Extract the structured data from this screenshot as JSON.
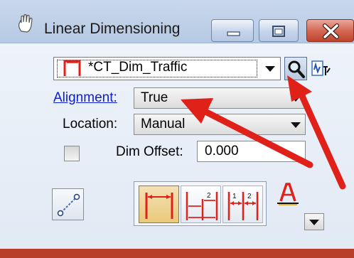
{
  "window": {
    "title": "Linear Dimensioning",
    "icon": "hand-icon",
    "controls": {
      "minimize": "minimize-icon",
      "maximize": "maximize-icon",
      "close": "close-icon"
    }
  },
  "dimension_style": {
    "value": "*CT_Dim_Traffic",
    "icon": "dimension-style-icon",
    "buttons": {
      "search": "magnifier-icon",
      "pick": "pick-style-icon"
    }
  },
  "alignment": {
    "label": "Alignment:",
    "value": "True"
  },
  "location": {
    "label": "Location:",
    "value": "Manual"
  },
  "dim_offset": {
    "checked": false,
    "label": "Dim Offset:",
    "value": "0.000"
  },
  "tools": {
    "main_tool_icon": "dimension-element-icon",
    "group": [
      {
        "name": "dimension-size-arrow-icon",
        "active": true
      },
      {
        "name": "dimension-size-stroke-icon",
        "active": false
      },
      {
        "name": "dimension-location-stacked-icon",
        "active": false
      }
    ],
    "text_tool_icon": "dimension-text-icon"
  },
  "colors": {
    "accent_red": "#e0211a",
    "link_blue": "#0b1ecf",
    "close_red": "#c9523c"
  }
}
